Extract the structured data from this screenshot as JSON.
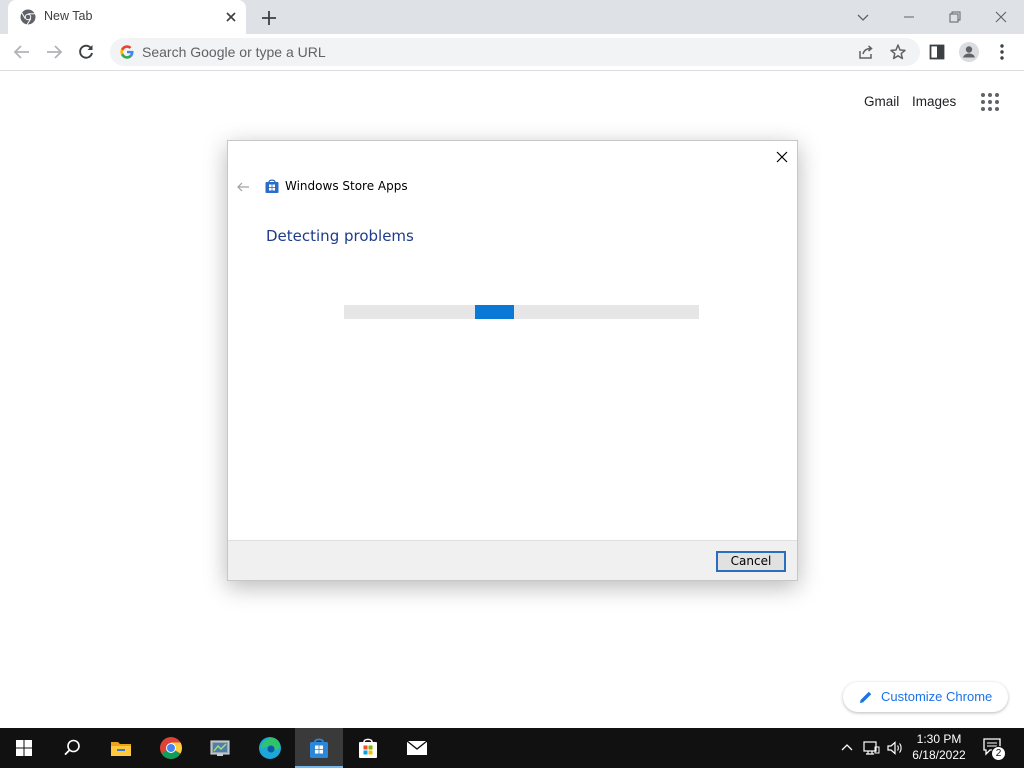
{
  "browser": {
    "tab": {
      "title": "New Tab"
    },
    "omnibox": {
      "placeholder": "Search Google or type a URL"
    }
  },
  "new_tab_page": {
    "links": {
      "gmail": "Gmail",
      "images": "Images"
    },
    "customize_label": "Customize Chrome"
  },
  "dialog": {
    "app_title": "Windows Store Apps",
    "heading": "Detecting problems",
    "progress_fraction": 0.11,
    "cancel_label": "Cancel"
  },
  "taskbar": {
    "apps": [
      {
        "name": "file-explorer-icon"
      },
      {
        "name": "chrome-icon"
      },
      {
        "name": "control-panel-icon"
      },
      {
        "name": "edge-icon"
      },
      {
        "name": "troubleshooter-icon",
        "active": true
      },
      {
        "name": "microsoft-store-icon"
      },
      {
        "name": "mail-icon"
      }
    ],
    "clock": {
      "time": "1:30 PM",
      "date": "6/18/2022"
    },
    "notifications_count": "2"
  },
  "colors": {
    "accent_blue": "#1a73e8",
    "dialog_heading": "#1e3c8c",
    "progress_fill": "#0a78d7",
    "taskbar_bg": "#111111"
  }
}
